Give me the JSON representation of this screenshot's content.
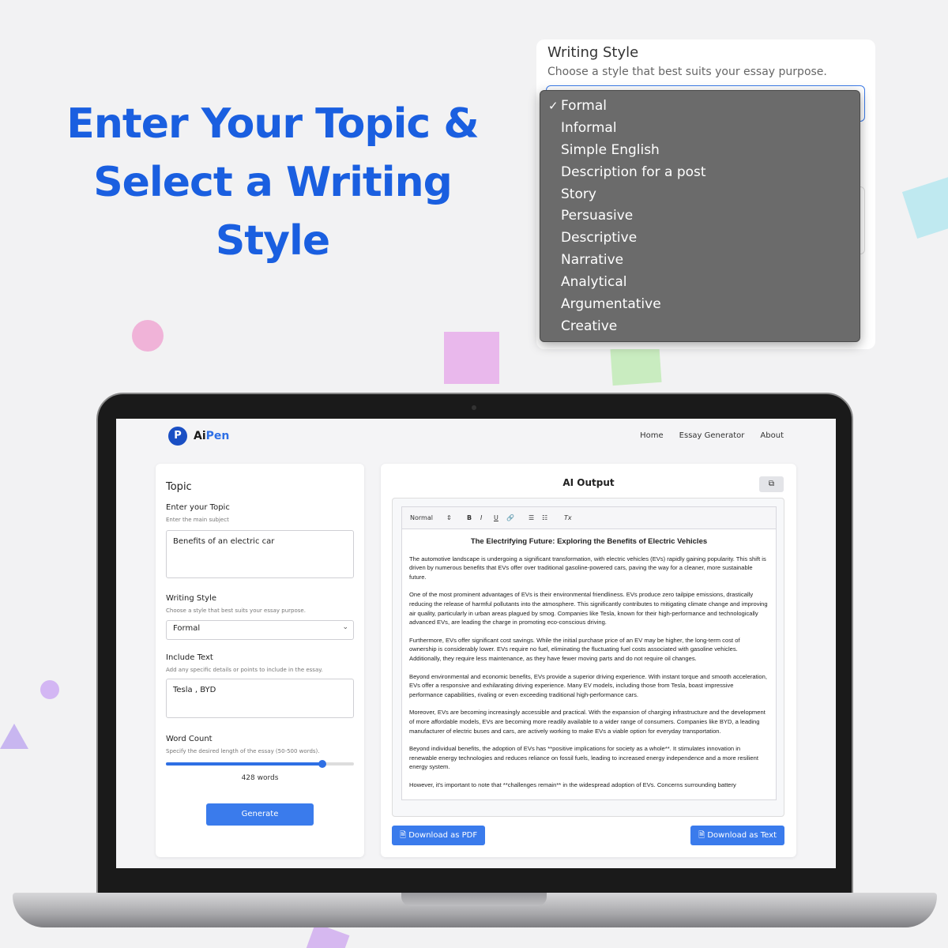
{
  "headline": {
    "line1": "Enter Your Topic &",
    "line2": "Select a Writing",
    "line3": "Style"
  },
  "style_popup": {
    "title": "Writing Style",
    "subtitle": "Choose a style that best suits your essay purpose.",
    "selected_mark": "✓",
    "options": [
      "Formal",
      "Informal",
      "Simple English",
      "Description for a post",
      "Story",
      "Persuasive",
      "Descriptive",
      "Narrative",
      "Analytical",
      "Argumentative",
      "Creative"
    ]
  },
  "nav": {
    "logo_glyph": "P",
    "brand_ai": "Ai",
    "brand_pen": "Pen",
    "links": [
      "Home",
      "Essay Generator",
      "About"
    ]
  },
  "form": {
    "title": "Topic",
    "topic_label": "Enter your Topic",
    "topic_hint": "Enter the main subject",
    "topic_value": "Benefits of an electric car",
    "style_label": "Writing Style",
    "style_hint": "Choose a style that best suits your essay purpose.",
    "style_value": "Formal",
    "include_label": "Include Text",
    "include_hint": "Add any specific details or points to include in the essay.",
    "include_value": "Tesla , BYD",
    "wordcount_label": "Word Count",
    "wordcount_hint": "Specify the desired length of the essay (50-500 words).",
    "wordcount_fraction": 0.83,
    "wordcount_value": "428 words",
    "generate_label": "Generate"
  },
  "output": {
    "title": "AI Output",
    "copy_icon": "copy-icon",
    "toolbar": {
      "format": "Normal",
      "bold": "B",
      "italic": "I",
      "underline": "U",
      "link": "🔗",
      "ordered_list": "☰",
      "bullet_list": "☷",
      "clear_format": "Tx"
    },
    "essay_title": "The Electrifying Future: Exploring the Benefits of Electric Vehicles",
    "paragraphs": [
      "The automotive landscape is undergoing a significant transformation, with electric vehicles (EVs) rapidly gaining popularity. This shift is driven by numerous benefits that EVs offer over traditional gasoline-powered cars, paving the way for a cleaner, more sustainable future.",
      "One of the most prominent advantages of EVs is their environmental friendliness. EVs produce zero tailpipe emissions, drastically reducing the release of harmful pollutants into the atmosphere. This significantly contributes to mitigating climate change and improving air quality, particularly in urban areas plagued by smog. Companies like Tesla, known for their high-performance and technologically advanced EVs, are leading the charge in promoting eco-conscious driving.",
      "Furthermore, EVs offer significant cost savings. While the initial purchase price of an EV may be higher, the long-term cost of ownership is considerably lower. EVs require no fuel, eliminating the fluctuating fuel costs associated with gasoline vehicles. Additionally, they require less maintenance, as they have fewer moving parts and do not require oil changes.",
      "Beyond environmental and economic benefits, EVs provide a superior driving experience. With instant torque and smooth acceleration, EVs offer a responsive and exhilarating driving experience. Many EV models, including those from Tesla, boast impressive performance capabilities, rivaling or even exceeding traditional high-performance cars.",
      "Moreover, EVs are becoming increasingly accessible and practical. With the expansion of charging infrastructure and the development of more affordable models, EVs are becoming more readily available to a wider range of consumers. Companies like BYD, a leading manufacturer of electric buses and cars, are actively working to make EVs a viable option for everyday transportation.",
      "Beyond individual benefits, the adoption of EVs has **positive implications for society as a whole**. It stimulates innovation in renewable energy technologies and reduces reliance on fossil fuels, leading to increased energy independence and a more resilient energy system.",
      "However, it's important to note that **challenges remain** in the widespread adoption of EVs. Concerns surrounding battery"
    ],
    "download_pdf": "Download as PDF",
    "download_text": "Download as Text"
  },
  "colors": {
    "headline": "#1a5fe0",
    "accent": "#3a7bec",
    "dropdown_bg": "#6b6b6b"
  }
}
